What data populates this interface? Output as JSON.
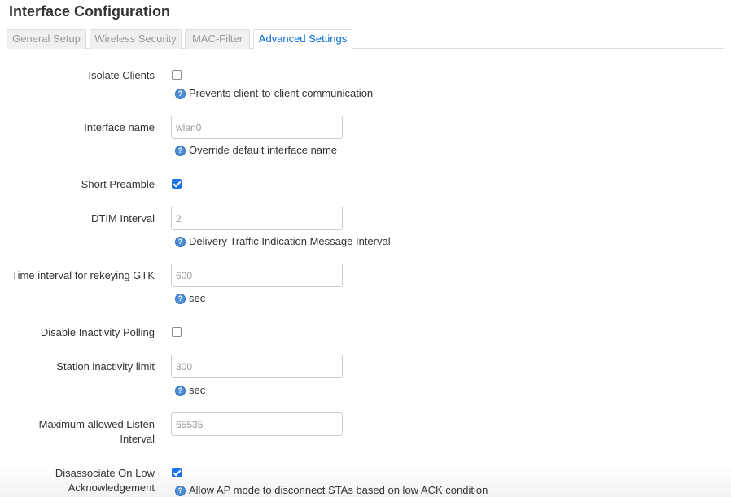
{
  "header": {
    "title": "Interface Configuration"
  },
  "tabs": [
    {
      "label": "General Setup",
      "active": false
    },
    {
      "label": "Wireless Security",
      "active": false
    },
    {
      "label": "MAC-Filter",
      "active": false
    },
    {
      "label": "Advanced Settings",
      "active": true
    }
  ],
  "fields": {
    "isolate_clients": {
      "label": "Isolate Clients",
      "checked": false,
      "help": "Prevents client-to-client communication"
    },
    "interface_name": {
      "label": "Interface name",
      "placeholder": "wlan0",
      "help": "Override default interface name"
    },
    "short_preamble": {
      "label": "Short Preamble",
      "checked": true
    },
    "dtim_interval": {
      "label": "DTIM Interval",
      "placeholder": "2",
      "help": "Delivery Traffic Indication Message Interval"
    },
    "rekey_gtk": {
      "label": "Time interval for rekeying GTK",
      "placeholder": "600",
      "help": "sec"
    },
    "disable_inactivity_polling": {
      "label": "Disable Inactivity Polling",
      "checked": false
    },
    "station_inactivity_limit": {
      "label": "Station inactivity limit",
      "placeholder": "300",
      "help": "sec"
    },
    "max_listen_interval": {
      "label_line1": "Maximum allowed Listen",
      "label_line2": "Interval",
      "placeholder": "65535"
    },
    "disassoc_low_ack": {
      "label_line1": "Disassociate On Low",
      "label_line2": "Acknowledgement",
      "checked": true,
      "help": "Allow AP mode to disconnect STAs based on low ACK condition"
    }
  },
  "icons": {
    "help": "help-icon"
  },
  "colors": {
    "accent": "#0069d6",
    "checkbox_checked": "#1a73e8",
    "help_icon": "#4f8fd6"
  }
}
